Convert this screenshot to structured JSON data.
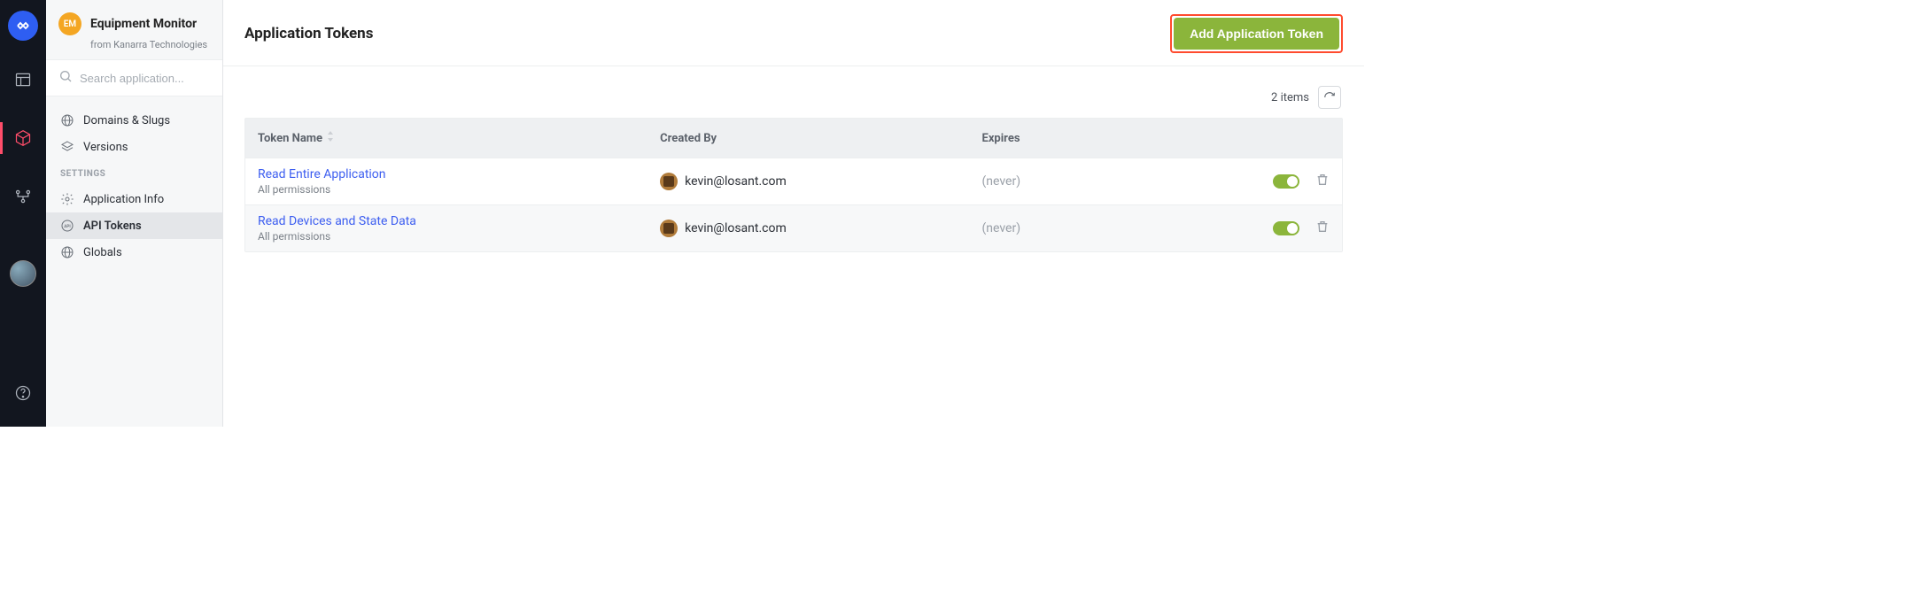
{
  "app": {
    "badge": "EM",
    "name": "Equipment Monitor",
    "subtitle": "from Kanarra Technologies"
  },
  "search": {
    "placeholder": "Search application..."
  },
  "sidebar": {
    "items": [
      {
        "label": "Domains & Slugs",
        "active": false
      },
      {
        "label": "Versions",
        "active": false
      }
    ],
    "settings_heading": "SETTINGS",
    "settings": [
      {
        "label": "Application Info",
        "active": false
      },
      {
        "label": "API Tokens",
        "active": true
      },
      {
        "label": "Globals",
        "active": false
      }
    ]
  },
  "page": {
    "title": "Application Tokens",
    "add_button": "Add Application Token",
    "count_label": "2 items"
  },
  "table": {
    "columns": {
      "name": "Token Name",
      "created_by": "Created By",
      "expires": "Expires"
    },
    "rows": [
      {
        "name": "Read Entire Application",
        "perms": "All permissions",
        "created_by": "kevin@losant.com",
        "expires": "(never)",
        "enabled": true
      },
      {
        "name": "Read Devices and State Data",
        "perms": "All permissions",
        "created_by": "kevin@losant.com",
        "expires": "(never)",
        "enabled": true
      }
    ]
  }
}
